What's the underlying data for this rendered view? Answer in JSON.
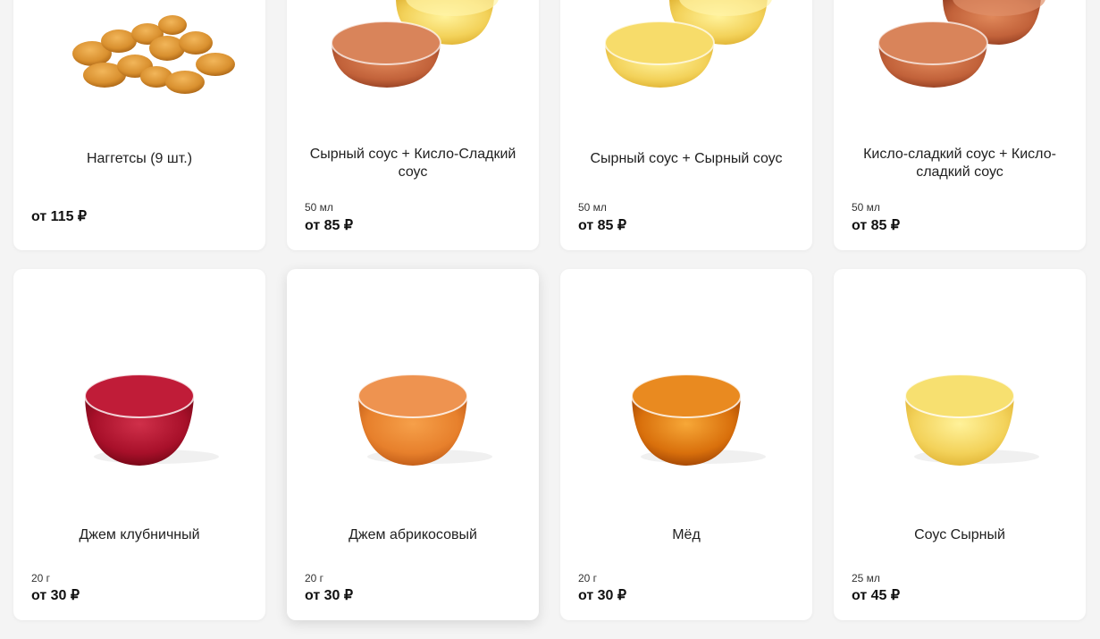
{
  "products": [
    {
      "name": "Наггетсы (9 шт.)",
      "size": "",
      "price": "от 115 ₽",
      "image": "nuggets"
    },
    {
      "name": "Сырный соус + Кисло-Сладкий соус",
      "size": "50 мл",
      "price": "от 85 ₽",
      "image": "sweet-sour-and-cheese-sauce"
    },
    {
      "name": "Сырный соус + Сырный соус",
      "size": "50 мл",
      "price": "от 85 ₽",
      "image": "cheese-and-cheese-sauce"
    },
    {
      "name": "Кисло-сладкий соус + Кисло-сладкий соус",
      "size": "50 мл",
      "price": "от 85 ₽",
      "image": "sweet-sour-and-sweet-sour-sauce"
    },
    {
      "name": "Джем клубничный",
      "size": "20 г",
      "price": "от 30 ₽",
      "image": "strawberry-jam-bowl"
    },
    {
      "name": "Джем абрикосовый",
      "size": "20 г",
      "price": "от 30 ₽",
      "image": "apricot-jam-bowl"
    },
    {
      "name": "Мёд",
      "size": "20 г",
      "price": "от 30 ₽",
      "image": "honey-bowl"
    },
    {
      "name": "Соус Сырный",
      "size": "25 мл",
      "price": "от 45 ₽",
      "image": "cheese-sauce-bowl"
    }
  ],
  "colors": {
    "cheese": "#f3d25a",
    "sweet_sour": "#c2623a",
    "strawberry": "#a8102a",
    "apricot": "#e7802c",
    "honey": "#d9700c",
    "nugget": "#d9902f"
  }
}
